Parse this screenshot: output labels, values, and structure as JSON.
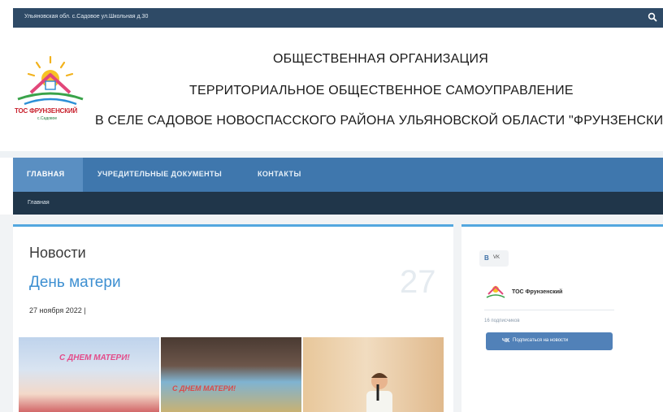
{
  "topbar": {
    "address": "Ульяновская обл. с.Садовое ул.Школьная д.30",
    "search_icon": "search-icon"
  },
  "logo": {
    "line1": "ТОС ФРУНЗЕНСКИЙ",
    "line2": "с.Садовое",
    "icon": "sun-house-logo"
  },
  "header": {
    "line1": "ОБЩЕСТВЕННАЯ ОРГАНИЗАЦИЯ",
    "line2": "ТЕРРИТОРИАЛЬНОЕ ОБЩЕСТВЕННОЕ САМОУПРАВЛЕНИЕ",
    "line3": "В СЕЛЕ САДОВОЕ НОВОСПАССКОГО РАЙОНА УЛЬЯНОВСКОЙ ОБЛАСТИ \"ФРУНЗЕНСКИЙ"
  },
  "nav": {
    "items": [
      {
        "label": "ГЛАВНАЯ",
        "active": true
      },
      {
        "label": "УЧРЕДИТЕЛЬНЫЕ ДОКУМЕНТЫ",
        "active": false
      },
      {
        "label": "КОНТАКТЫ",
        "active": false
      }
    ]
  },
  "breadcrumb": {
    "current": "Главная"
  },
  "news": {
    "heading": "Новости",
    "title": "День матери",
    "date": "27 ноября 2022 |",
    "day": "27",
    "photos": [
      {
        "banner": "С ДНЕМ МАТЕРИ!"
      },
      {
        "banner": "С ДНЕМ МАТЕРИ!"
      },
      {
        "banner": ""
      }
    ]
  },
  "sidebar": {
    "vk_tab_logo": "В",
    "vk_tab_label": "VK",
    "group_name": "ТОС Фрунзенский",
    "subscribers": "16 подписчиков",
    "button_icon": "ЧК",
    "button_label": "Подписаться на новости"
  },
  "colors": {
    "topbar": "#2e4a66",
    "nav": "#3f77ad",
    "nav_active": "#5a8fc2",
    "breadcrumb_bar": "#20364a",
    "accent": "#53a7df",
    "link": "#3d8fd1",
    "vk_button": "#5181b8"
  }
}
